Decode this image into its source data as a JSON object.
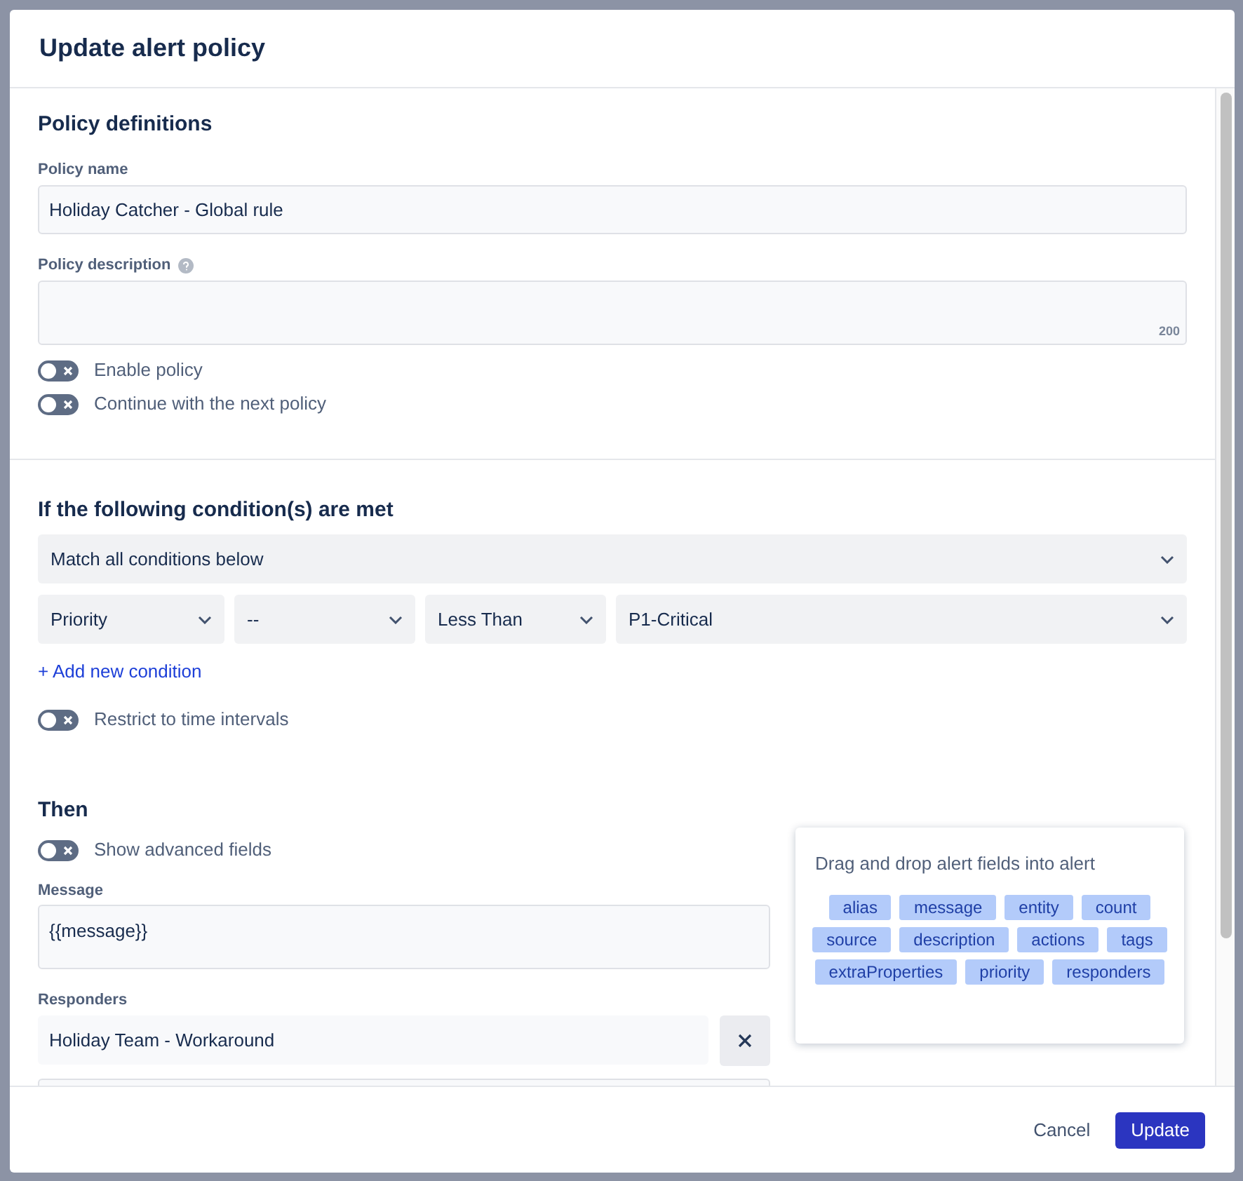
{
  "dialog": {
    "title": "Update alert policy"
  },
  "policy_definitions": {
    "heading": "Policy definitions",
    "name_field": {
      "label": "Policy name",
      "value": "Holiday Catcher - Global rule"
    },
    "description_field": {
      "label": "Policy description",
      "help_icon": true,
      "counter": "200"
    },
    "toggles": [
      {
        "label": "Enable policy",
        "on": false
      },
      {
        "label": "Continue with the next policy",
        "on": false
      }
    ]
  },
  "conditions": {
    "heading": "If the following condition(s) are met",
    "match_select": {
      "value": "Match all conditions below"
    },
    "condition_selects": [
      {
        "value": "Priority"
      },
      {
        "value": "--"
      },
      {
        "value": "Less Than"
      },
      {
        "value": "P1-Critical"
      }
    ],
    "add_link": "+ Add new condition",
    "toggles": [
      {
        "label": "Restrict to time intervals",
        "on": false
      }
    ]
  },
  "then": {
    "heading": "Then",
    "toggles": [
      {
        "label": "Show advanced fields",
        "on": false
      }
    ],
    "message_field": {
      "label": "Message",
      "value": "{{message}}"
    },
    "responders": {
      "label": "Responders",
      "items": [
        "Holiday Team - Workaround"
      ]
    }
  },
  "field_palette": {
    "title": "Drag and drop alert fields into alert",
    "chips": [
      "alias",
      "message",
      "entity",
      "count",
      "source",
      "description",
      "actions",
      "tags",
      "extraProperties",
      "priority",
      "responders"
    ]
  },
  "footer": {
    "buttons": [
      {
        "label": "Cancel",
        "kind": "secondary"
      },
      {
        "label": "Update",
        "kind": "primary"
      }
    ]
  }
}
